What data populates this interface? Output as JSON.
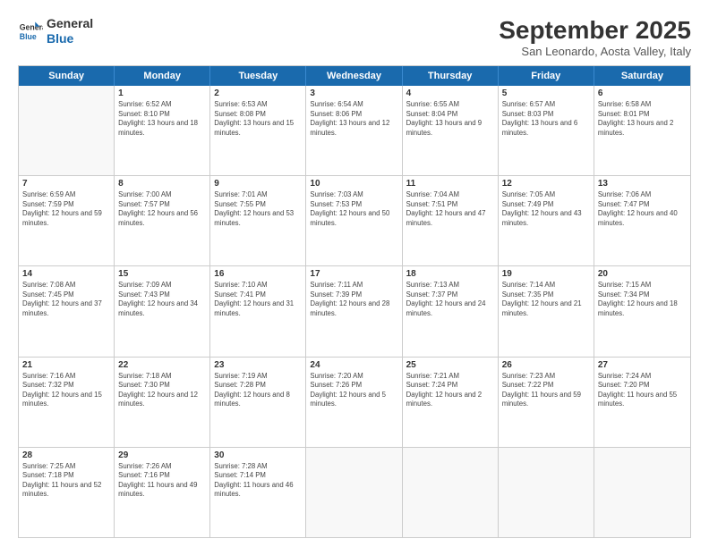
{
  "header": {
    "logo_line1": "General",
    "logo_line2": "Blue",
    "month": "September 2025",
    "location": "San Leonardo, Aosta Valley, Italy"
  },
  "weekdays": [
    "Sunday",
    "Monday",
    "Tuesday",
    "Wednesday",
    "Thursday",
    "Friday",
    "Saturday"
  ],
  "rows": [
    [
      {
        "day": "",
        "sunrise": "",
        "sunset": "",
        "daylight": ""
      },
      {
        "day": "1",
        "sunrise": "Sunrise: 6:52 AM",
        "sunset": "Sunset: 8:10 PM",
        "daylight": "Daylight: 13 hours and 18 minutes."
      },
      {
        "day": "2",
        "sunrise": "Sunrise: 6:53 AM",
        "sunset": "Sunset: 8:08 PM",
        "daylight": "Daylight: 13 hours and 15 minutes."
      },
      {
        "day": "3",
        "sunrise": "Sunrise: 6:54 AM",
        "sunset": "Sunset: 8:06 PM",
        "daylight": "Daylight: 13 hours and 12 minutes."
      },
      {
        "day": "4",
        "sunrise": "Sunrise: 6:55 AM",
        "sunset": "Sunset: 8:04 PM",
        "daylight": "Daylight: 13 hours and 9 minutes."
      },
      {
        "day": "5",
        "sunrise": "Sunrise: 6:57 AM",
        "sunset": "Sunset: 8:03 PM",
        "daylight": "Daylight: 13 hours and 6 minutes."
      },
      {
        "day": "6",
        "sunrise": "Sunrise: 6:58 AM",
        "sunset": "Sunset: 8:01 PM",
        "daylight": "Daylight: 13 hours and 2 minutes."
      }
    ],
    [
      {
        "day": "7",
        "sunrise": "Sunrise: 6:59 AM",
        "sunset": "Sunset: 7:59 PM",
        "daylight": "Daylight: 12 hours and 59 minutes."
      },
      {
        "day": "8",
        "sunrise": "Sunrise: 7:00 AM",
        "sunset": "Sunset: 7:57 PM",
        "daylight": "Daylight: 12 hours and 56 minutes."
      },
      {
        "day": "9",
        "sunrise": "Sunrise: 7:01 AM",
        "sunset": "Sunset: 7:55 PM",
        "daylight": "Daylight: 12 hours and 53 minutes."
      },
      {
        "day": "10",
        "sunrise": "Sunrise: 7:03 AM",
        "sunset": "Sunset: 7:53 PM",
        "daylight": "Daylight: 12 hours and 50 minutes."
      },
      {
        "day": "11",
        "sunrise": "Sunrise: 7:04 AM",
        "sunset": "Sunset: 7:51 PM",
        "daylight": "Daylight: 12 hours and 47 minutes."
      },
      {
        "day": "12",
        "sunrise": "Sunrise: 7:05 AM",
        "sunset": "Sunset: 7:49 PM",
        "daylight": "Daylight: 12 hours and 43 minutes."
      },
      {
        "day": "13",
        "sunrise": "Sunrise: 7:06 AM",
        "sunset": "Sunset: 7:47 PM",
        "daylight": "Daylight: 12 hours and 40 minutes."
      }
    ],
    [
      {
        "day": "14",
        "sunrise": "Sunrise: 7:08 AM",
        "sunset": "Sunset: 7:45 PM",
        "daylight": "Daylight: 12 hours and 37 minutes."
      },
      {
        "day": "15",
        "sunrise": "Sunrise: 7:09 AM",
        "sunset": "Sunset: 7:43 PM",
        "daylight": "Daylight: 12 hours and 34 minutes."
      },
      {
        "day": "16",
        "sunrise": "Sunrise: 7:10 AM",
        "sunset": "Sunset: 7:41 PM",
        "daylight": "Daylight: 12 hours and 31 minutes."
      },
      {
        "day": "17",
        "sunrise": "Sunrise: 7:11 AM",
        "sunset": "Sunset: 7:39 PM",
        "daylight": "Daylight: 12 hours and 28 minutes."
      },
      {
        "day": "18",
        "sunrise": "Sunrise: 7:13 AM",
        "sunset": "Sunset: 7:37 PM",
        "daylight": "Daylight: 12 hours and 24 minutes."
      },
      {
        "day": "19",
        "sunrise": "Sunrise: 7:14 AM",
        "sunset": "Sunset: 7:35 PM",
        "daylight": "Daylight: 12 hours and 21 minutes."
      },
      {
        "day": "20",
        "sunrise": "Sunrise: 7:15 AM",
        "sunset": "Sunset: 7:34 PM",
        "daylight": "Daylight: 12 hours and 18 minutes."
      }
    ],
    [
      {
        "day": "21",
        "sunrise": "Sunrise: 7:16 AM",
        "sunset": "Sunset: 7:32 PM",
        "daylight": "Daylight: 12 hours and 15 minutes."
      },
      {
        "day": "22",
        "sunrise": "Sunrise: 7:18 AM",
        "sunset": "Sunset: 7:30 PM",
        "daylight": "Daylight: 12 hours and 12 minutes."
      },
      {
        "day": "23",
        "sunrise": "Sunrise: 7:19 AM",
        "sunset": "Sunset: 7:28 PM",
        "daylight": "Daylight: 12 hours and 8 minutes."
      },
      {
        "day": "24",
        "sunrise": "Sunrise: 7:20 AM",
        "sunset": "Sunset: 7:26 PM",
        "daylight": "Daylight: 12 hours and 5 minutes."
      },
      {
        "day": "25",
        "sunrise": "Sunrise: 7:21 AM",
        "sunset": "Sunset: 7:24 PM",
        "daylight": "Daylight: 12 hours and 2 minutes."
      },
      {
        "day": "26",
        "sunrise": "Sunrise: 7:23 AM",
        "sunset": "Sunset: 7:22 PM",
        "daylight": "Daylight: 11 hours and 59 minutes."
      },
      {
        "day": "27",
        "sunrise": "Sunrise: 7:24 AM",
        "sunset": "Sunset: 7:20 PM",
        "daylight": "Daylight: 11 hours and 55 minutes."
      }
    ],
    [
      {
        "day": "28",
        "sunrise": "Sunrise: 7:25 AM",
        "sunset": "Sunset: 7:18 PM",
        "daylight": "Daylight: 11 hours and 52 minutes."
      },
      {
        "day": "29",
        "sunrise": "Sunrise: 7:26 AM",
        "sunset": "Sunset: 7:16 PM",
        "daylight": "Daylight: 11 hours and 49 minutes."
      },
      {
        "day": "30",
        "sunrise": "Sunrise: 7:28 AM",
        "sunset": "Sunset: 7:14 PM",
        "daylight": "Daylight: 11 hours and 46 minutes."
      },
      {
        "day": "",
        "sunrise": "",
        "sunset": "",
        "daylight": ""
      },
      {
        "day": "",
        "sunrise": "",
        "sunset": "",
        "daylight": ""
      },
      {
        "day": "",
        "sunrise": "",
        "sunset": "",
        "daylight": ""
      },
      {
        "day": "",
        "sunrise": "",
        "sunset": "",
        "daylight": ""
      }
    ]
  ]
}
